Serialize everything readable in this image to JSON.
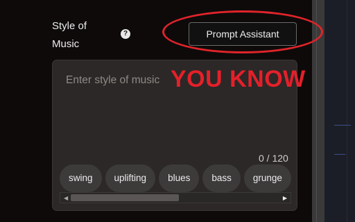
{
  "field": {
    "label": "Style of Music",
    "help_icon": "question-circle-icon"
  },
  "prompt_assistant": {
    "label": "Prompt Assistant"
  },
  "style_input": {
    "placeholder": "Enter style of music",
    "value": "",
    "counter": "0 / 120"
  },
  "overlay": {
    "text": "YOU KNOW",
    "color": "#e3202a"
  },
  "annotation_circle": {
    "color": "#e0242a"
  },
  "chips": [
    {
      "label": "swing"
    },
    {
      "label": "uplifting"
    },
    {
      "label": "blues"
    },
    {
      "label": "bass"
    },
    {
      "label": "grunge"
    }
  ],
  "scrollbar": {
    "left_arrow_icon": "triangle-left-icon",
    "right_arrow_icon": "triangle-right-icon",
    "position": 0.0
  },
  "colors": {
    "background": "#0e0a0a",
    "input_background": "#2b2827",
    "chip_background": "#3d3a3a"
  }
}
